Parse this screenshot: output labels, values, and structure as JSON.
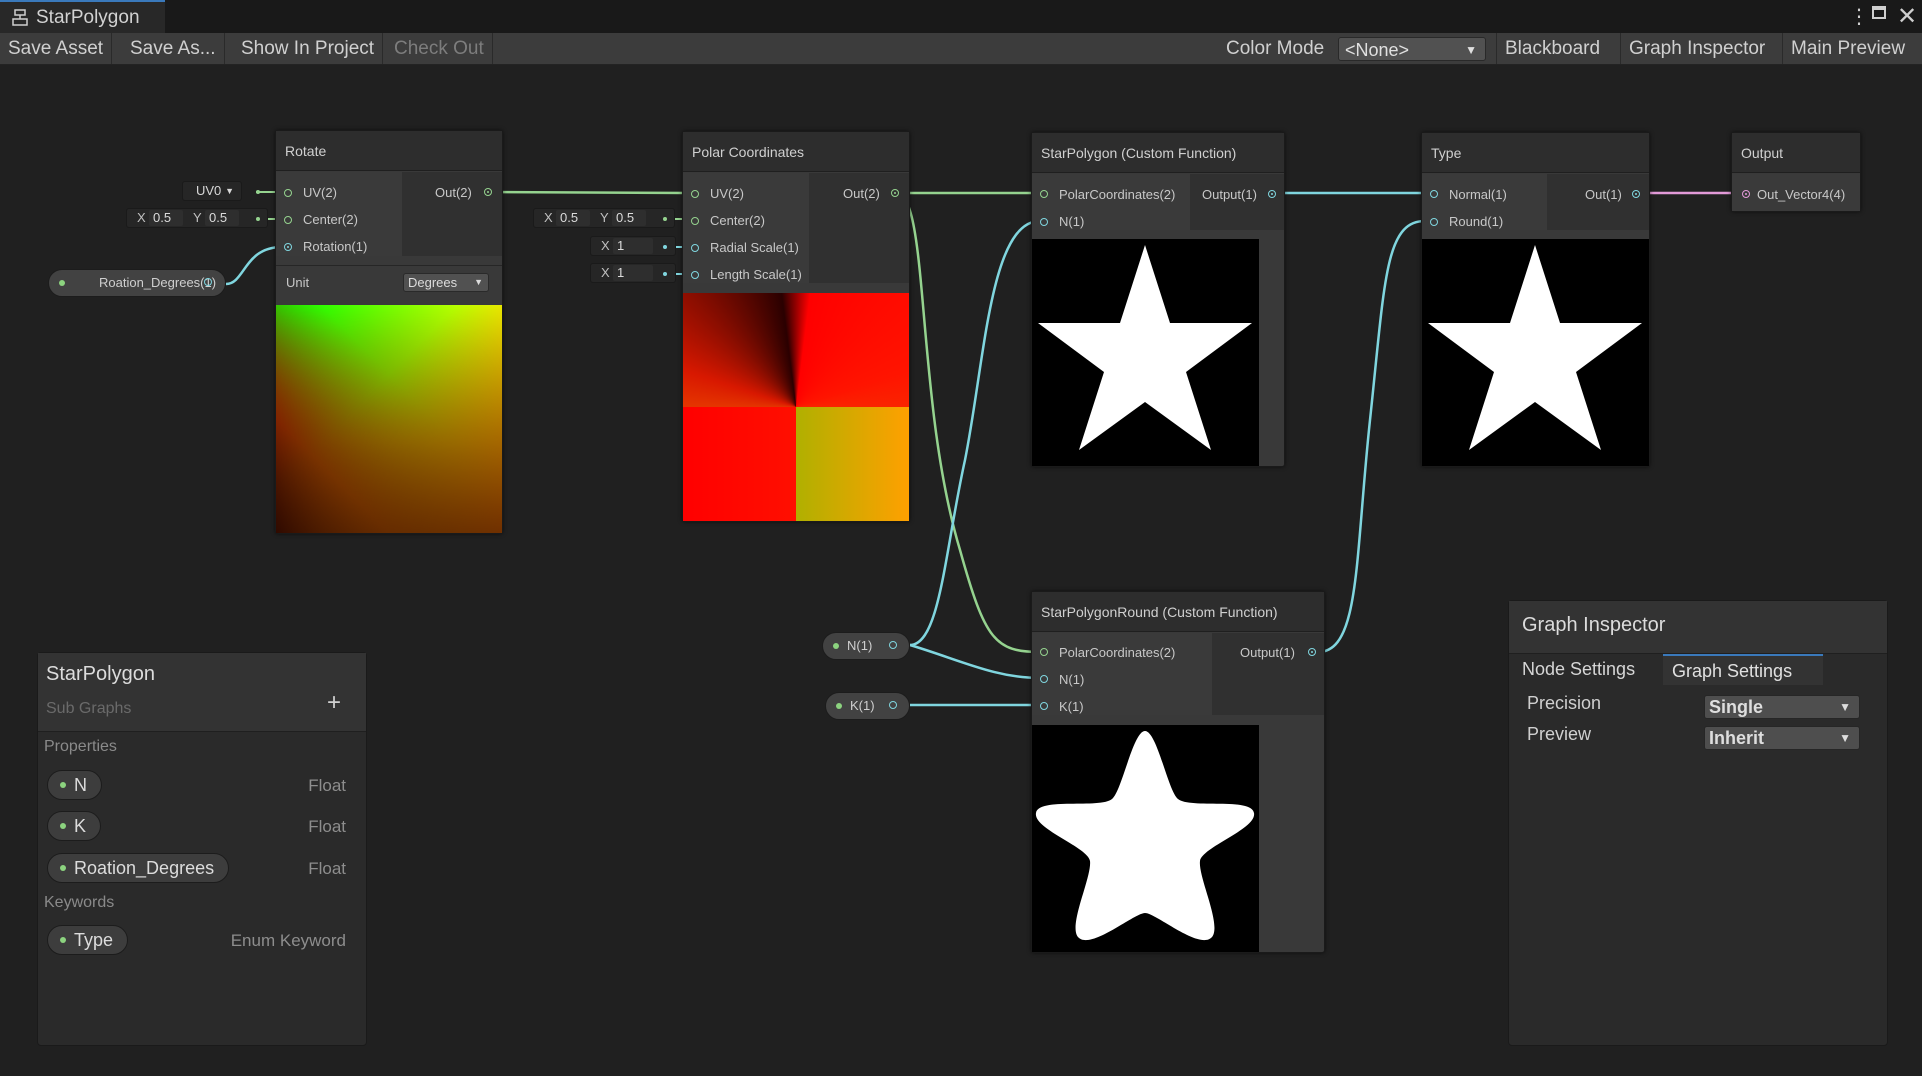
{
  "window": {
    "tab_title": "StarPolygon",
    "menu_icon": "kebab-menu-icon",
    "maximize_icon": "maximize-icon",
    "close_icon": "close-icon"
  },
  "toolbar": {
    "save_asset": "Save Asset",
    "save_as": "Save As...",
    "show_in_project": "Show In Project",
    "check_out": "Check Out",
    "color_mode_label": "Color Mode",
    "color_mode_value": "<None>",
    "blackboard": "Blackboard",
    "graph_inspector": "Graph Inspector",
    "main_preview": "Main Preview"
  },
  "nodes": {
    "rotate": {
      "title": "Rotate",
      "inputs": [
        "UV(2)",
        "Center(2)",
        "Rotation(1)"
      ],
      "outputs": [
        "Out(2)"
      ],
      "unit_label": "Unit",
      "unit_value": "Degrees",
      "uv_default": "UV0",
      "center_x_label": "X",
      "center_x": "0.5",
      "center_y_label": "Y",
      "center_y": "0.5"
    },
    "polar": {
      "title": "Polar Coordinates",
      "inputs": [
        "UV(2)",
        "Center(2)",
        "Radial Scale(1)",
        "Length Scale(1)"
      ],
      "outputs": [
        "Out(2)"
      ],
      "center_x_label": "X",
      "center_x": "0.5",
      "center_y_label": "Y",
      "center_y": "0.5",
      "radial_label": "X",
      "radial": "1",
      "length_label": "X",
      "length": "1"
    },
    "starpolygon": {
      "title": "StarPolygon (Custom Function)",
      "inputs": [
        "PolarCoordinates(2)",
        "N(1)"
      ],
      "outputs": [
        "Output(1)"
      ]
    },
    "starpolygonround": {
      "title": "StarPolygonRound (Custom Function)",
      "inputs": [
        "PolarCoordinates(2)",
        "N(1)",
        "K(1)"
      ],
      "outputs": [
        "Output(1)"
      ]
    },
    "type": {
      "title": "Type",
      "inputs": [
        "Normal(1)",
        "Round(1)"
      ],
      "outputs": [
        "Out(1)"
      ]
    },
    "output": {
      "title": "Output",
      "inputs": [
        "Out_Vector4(4)"
      ]
    }
  },
  "canvas_properties": {
    "rotation": "Roation_Degrees(1)",
    "n": "N(1)",
    "k": "K(1)"
  },
  "blackboard": {
    "title": "StarPolygon",
    "subtitle": "Sub Graphs",
    "add_icon": "plus-icon",
    "properties_label": "Properties",
    "properties": [
      {
        "name": "N",
        "type": "Float"
      },
      {
        "name": "K",
        "type": "Float"
      },
      {
        "name": "Roation_Degrees",
        "type": "Float"
      }
    ],
    "keywords_label": "Keywords",
    "keywords": [
      {
        "name": "Type",
        "type": "Enum Keyword"
      }
    ]
  },
  "inspector": {
    "title": "Graph Inspector",
    "tabs": [
      "Node Settings",
      "Graph Settings"
    ],
    "active_tab": "Graph Settings",
    "precision_label": "Precision",
    "precision_value": "Single",
    "preview_label": "Preview",
    "preview_value": "Inherit"
  },
  "colors": {
    "accent": "#3a79bb",
    "vector2_wire": "#95d38f",
    "float_wire": "#80d6df",
    "vector4_wire": "#e29ad8"
  }
}
